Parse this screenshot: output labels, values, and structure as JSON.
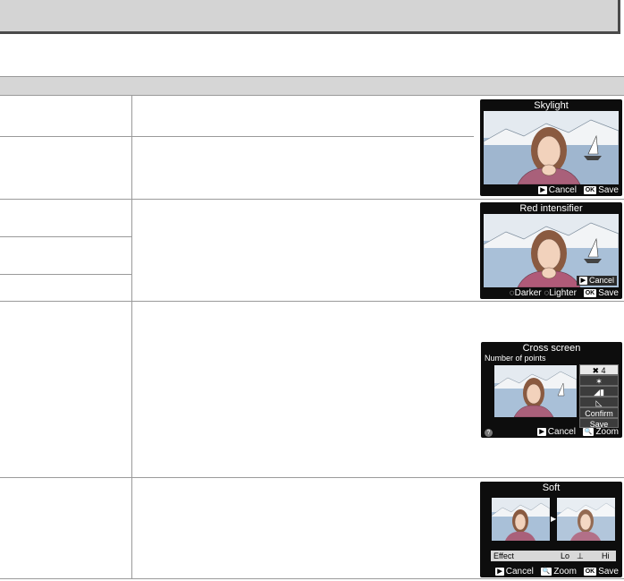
{
  "title_bar": {
    "text": ""
  },
  "table": {
    "header_col1": "",
    "header_col2": ""
  },
  "screens": {
    "skylight": {
      "title": "Skylight",
      "cancel": "Cancel",
      "save": "Save",
      "cancel_key": "▶",
      "save_key": "OK"
    },
    "red": {
      "title": "Red intensifier",
      "cancel_btn": "Cancel",
      "darker": "Darker",
      "lighter": "Lighter",
      "save": "Save",
      "save_key": "OK"
    },
    "cross": {
      "title": "Cross screen",
      "subtitle": "Number of points",
      "options": [
        "4",
        "",
        "",
        "",
        "Confirm",
        "Save"
      ],
      "help": "?",
      "cancel": "Cancel",
      "zoom": "Zoom"
    },
    "soft": {
      "title": "Soft",
      "effect": "Effect",
      "lo": "Lo",
      "hi": "Hi",
      "cancel": "Cancel",
      "zoom": "Zoom",
      "save": "Save",
      "save_key": "OK"
    }
  }
}
